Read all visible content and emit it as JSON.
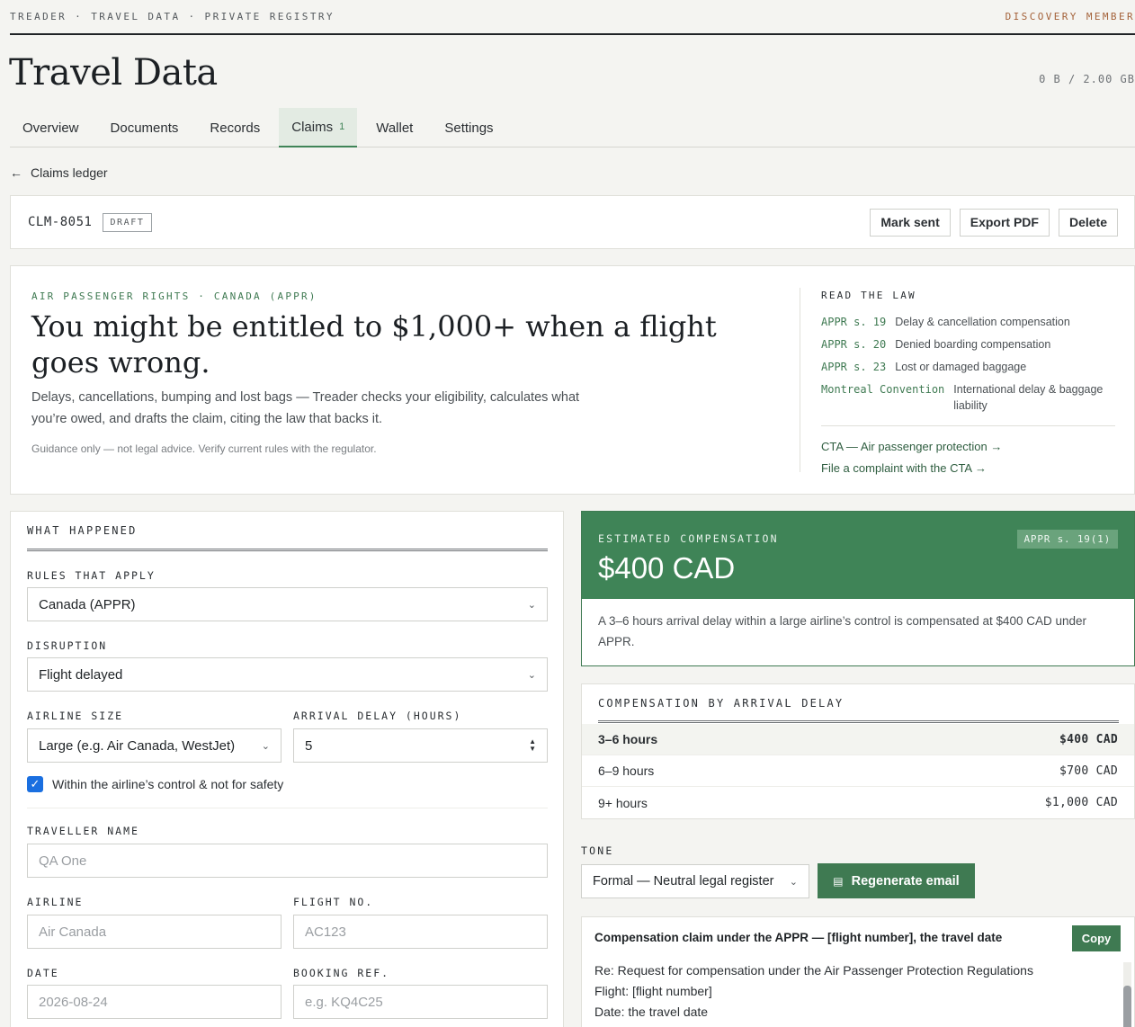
{
  "topbar": {
    "crumbs": "TREADER · TRAVEL DATA · PRIVATE REGISTRY",
    "member": "DISCOVERY MEMBER"
  },
  "page": {
    "title": "Travel Data",
    "storage": "0 B / 2.00 GB"
  },
  "tabs": [
    {
      "label": "Overview"
    },
    {
      "label": "Documents"
    },
    {
      "label": "Records"
    },
    {
      "label": "Claims",
      "count": "1",
      "active": true
    },
    {
      "label": "Wallet"
    },
    {
      "label": "Settings"
    }
  ],
  "back": {
    "label": "Claims ledger"
  },
  "claim": {
    "id": "CLM-8051",
    "status": "DRAFT",
    "actions": {
      "mark_sent": "Mark sent",
      "export_pdf": "Export PDF",
      "delete": "Delete"
    }
  },
  "hero": {
    "eyebrow": "AIR PASSENGER RIGHTS · CANADA (APPR)",
    "headline": "You might be entitled to $1,000+ when a flight goes wrong.",
    "description": "Delays, cancellations, bumping and lost bags — Treader checks your eligibility, calculates what you’re owed, and drafts the claim, citing the law that backs it.",
    "disclaimer": "Guidance only — not legal advice. Verify current rules with the regulator."
  },
  "law": {
    "heading": "READ THE LAW",
    "items": [
      {
        "ref": "APPR s. 19",
        "text": "Delay & cancellation compensation"
      },
      {
        "ref": "APPR s. 20",
        "text": "Denied boarding compensation"
      },
      {
        "ref": "APPR s. 23",
        "text": "Lost or damaged baggage"
      },
      {
        "ref": "Montreal Convention",
        "text": "International delay & baggage liability"
      }
    ],
    "links": [
      "CTA — Air passenger protection →",
      "File a complaint with the CTA →"
    ]
  },
  "form": {
    "section": "WHAT HAPPENED",
    "rules_label": "RULES THAT APPLY",
    "rules_value": "Canada (APPR)",
    "disruption_label": "DISRUPTION",
    "disruption_value": "Flight delayed",
    "airline_size_label": "AIRLINE SIZE",
    "airline_size_value": "Large (e.g. Air Canada, WestJet)",
    "delay_label": "ARRIVAL DELAY (HOURS)",
    "delay_value": "5",
    "control_label": "Within the airline’s control & not for safety",
    "control_checked": true,
    "traveller_label": "TRAVELLER NAME",
    "traveller_placeholder": "QA One",
    "airline_label": "AIRLINE",
    "airline_placeholder": "Air Canada",
    "flight_label": "FLIGHT NO.",
    "flight_placeholder": "AC123",
    "date_label": "DATE",
    "date_placeholder": "2026-08-24",
    "booking_label": "BOOKING REF.",
    "booking_placeholder": "e.g. KQ4C25"
  },
  "estimate": {
    "label": "ESTIMATED COMPENSATION",
    "amount": "$400 CAD",
    "reference": "APPR s. 19(1)",
    "note": "A 3–6 hours arrival delay within a large airline’s control is compensated at $400 CAD under APPR."
  },
  "compensation_table": {
    "heading": "COMPENSATION BY ARRIVAL DELAY",
    "rows": [
      {
        "range": "3–6 hours",
        "amount": "$400 CAD",
        "selected": true
      },
      {
        "range": "6–9 hours",
        "amount": "$700 CAD"
      },
      {
        "range": "9+ hours",
        "amount": "$1,000 CAD"
      }
    ]
  },
  "tone": {
    "label": "TONE",
    "value": "Formal — Neutral legal register",
    "regenerate": "Regenerate email"
  },
  "email": {
    "subject": "Compensation claim under the APPR — [flight number], the travel date",
    "copy": "Copy",
    "lines": [
      "Re: Request for compensation under the Air Passenger Protection Regulations",
      "Flight: [flight number]",
      "Date: the travel date"
    ]
  },
  "colors": {
    "accent": "#3f8457",
    "accent_dark": "#3f7a52",
    "member": "#a4623a",
    "checkbox": "#1a6fe0"
  },
  "icons": {
    "back": "arrow-left-icon",
    "select": "chevron-down-icon",
    "stepper": "stepper-icon",
    "regenerate": "document-icon",
    "check": "checkmark-icon"
  }
}
